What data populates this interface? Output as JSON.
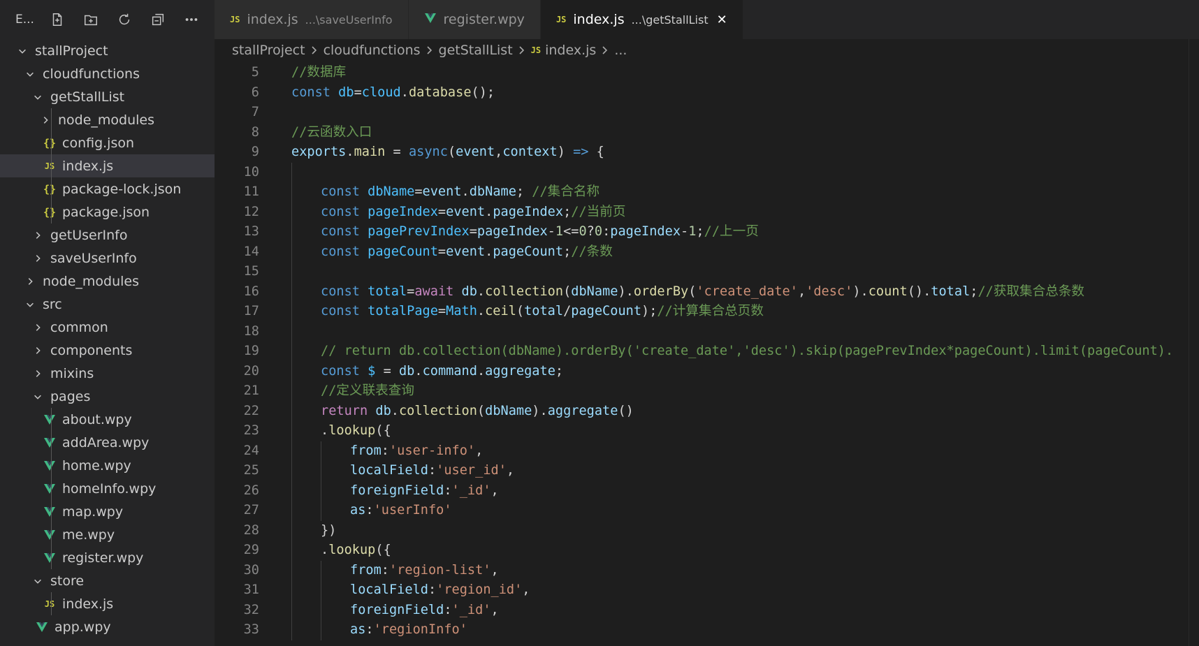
{
  "sidebar": {
    "title": "E...",
    "toolbar_icons": [
      "new-file-icon",
      "new-folder-icon",
      "refresh-icon",
      "collapse-all-icon",
      "more-icon"
    ],
    "tree": [
      {
        "label": "stallProject",
        "type": "folder",
        "open": true,
        "depth": 0
      },
      {
        "label": "cloudfunctions",
        "type": "folder",
        "open": true,
        "depth": 1
      },
      {
        "label": "getStallList",
        "type": "folder",
        "open": true,
        "depth": 2
      },
      {
        "label": "node_modules",
        "type": "folder",
        "open": false,
        "depth": 3
      },
      {
        "label": "config.json",
        "type": "json",
        "depth": 3
      },
      {
        "label": "index.js",
        "type": "js",
        "depth": 3,
        "selected": true
      },
      {
        "label": "package-lock.json",
        "type": "json",
        "depth": 3
      },
      {
        "label": "package.json",
        "type": "json",
        "depth": 3
      },
      {
        "label": "getUserInfo",
        "type": "folder",
        "open": false,
        "depth": 2
      },
      {
        "label": "saveUserInfo",
        "type": "folder",
        "open": false,
        "depth": 2
      },
      {
        "label": "node_modules",
        "type": "folder",
        "open": false,
        "depth": 1
      },
      {
        "label": "src",
        "type": "folder",
        "open": true,
        "depth": 1
      },
      {
        "label": "common",
        "type": "folder",
        "open": false,
        "depth": 2
      },
      {
        "label": "components",
        "type": "folder",
        "open": false,
        "depth": 2
      },
      {
        "label": "mixins",
        "type": "folder",
        "open": false,
        "depth": 2
      },
      {
        "label": "pages",
        "type": "folder",
        "open": true,
        "depth": 2
      },
      {
        "label": "about.wpy",
        "type": "vue",
        "depth": 3
      },
      {
        "label": "addArea.wpy",
        "type": "vue",
        "depth": 3
      },
      {
        "label": "home.wpy",
        "type": "vue",
        "depth": 3
      },
      {
        "label": "homeInfo.wpy",
        "type": "vue",
        "depth": 3
      },
      {
        "label": "map.wpy",
        "type": "vue",
        "depth": 3
      },
      {
        "label": "me.wpy",
        "type": "vue",
        "depth": 3
      },
      {
        "label": "register.wpy",
        "type": "vue",
        "depth": 3
      },
      {
        "label": "store",
        "type": "folder",
        "open": true,
        "depth": 2
      },
      {
        "label": "index.js",
        "type": "js",
        "depth": 3
      },
      {
        "label": "app.wpy",
        "type": "vue",
        "depth": 2
      }
    ]
  },
  "tabs": [
    {
      "label": "index.js",
      "desc": "...\\saveUserInfo",
      "type": "js",
      "active": false
    },
    {
      "label": "register.wpy",
      "desc": "",
      "type": "vue",
      "active": false
    },
    {
      "label": "index.js",
      "desc": "...\\getStallList",
      "type": "js",
      "active": true
    }
  ],
  "breadcrumb": [
    "stallProject",
    "cloudfunctions",
    "getStallList",
    "index.js",
    "..."
  ],
  "icons": {
    "js": "JS",
    "json": "{}"
  },
  "colors": {
    "keyword": "#569cd6",
    "variable": "#4fc1ff",
    "function": "#dcdcaa",
    "string": "#ce9178",
    "comment": "#6a9955",
    "property": "#9cdcfe",
    "number": "#b5cea8",
    "control": "#c586c0",
    "vue": "#41b883"
  },
  "code_lines": [
    {
      "n": "5",
      "indent": 0,
      "t": [
        [
          "c",
          "//数据库"
        ]
      ]
    },
    {
      "n": "6",
      "indent": 0,
      "t": [
        [
          "k",
          "const "
        ],
        [
          "v",
          "db"
        ],
        [
          "w",
          "="
        ],
        [
          "v",
          "cloud"
        ],
        [
          "w",
          "."
        ],
        [
          "f",
          "database"
        ],
        [
          "w",
          "();"
        ]
      ]
    },
    {
      "n": "7",
      "indent": 0,
      "t": []
    },
    {
      "n": "8",
      "indent": 0,
      "t": [
        [
          "c",
          "//云函数入口"
        ]
      ]
    },
    {
      "n": "9",
      "indent": 0,
      "t": [
        [
          "p",
          "exports"
        ],
        [
          "w",
          "."
        ],
        [
          "f",
          "main"
        ],
        [
          "w",
          " = "
        ],
        [
          "k",
          "async"
        ],
        [
          "w",
          "("
        ],
        [
          "p",
          "event"
        ],
        [
          "w",
          ","
        ],
        [
          "p",
          "context"
        ],
        [
          "w",
          ") "
        ],
        [
          "k",
          "=>"
        ],
        [
          "w",
          " {"
        ]
      ]
    },
    {
      "n": "10",
      "indent": 1,
      "t": []
    },
    {
      "n": "11",
      "indent": 1,
      "t": [
        [
          "k",
          "const "
        ],
        [
          "v",
          "dbName"
        ],
        [
          "w",
          "="
        ],
        [
          "p",
          "event"
        ],
        [
          "w",
          "."
        ],
        [
          "p",
          "dbName"
        ],
        [
          "w",
          "; "
        ],
        [
          "c",
          "//集合名称"
        ]
      ]
    },
    {
      "n": "12",
      "indent": 1,
      "t": [
        [
          "k",
          "const "
        ],
        [
          "v",
          "pageIndex"
        ],
        [
          "w",
          "="
        ],
        [
          "p",
          "event"
        ],
        [
          "w",
          "."
        ],
        [
          "p",
          "pageIndex"
        ],
        [
          "w",
          ";"
        ],
        [
          "c",
          "//当前页"
        ]
      ]
    },
    {
      "n": "13",
      "indent": 1,
      "t": [
        [
          "k",
          "const "
        ],
        [
          "v",
          "pagePrevIndex"
        ],
        [
          "w",
          "="
        ],
        [
          "p",
          "pageIndex"
        ],
        [
          "w",
          "-"
        ],
        [
          "n",
          "1"
        ],
        [
          "w",
          "<="
        ],
        [
          "n",
          "0"
        ],
        [
          "w",
          "?"
        ],
        [
          "n",
          "0"
        ],
        [
          "w",
          ":"
        ],
        [
          "p",
          "pageIndex"
        ],
        [
          "w",
          "-"
        ],
        [
          "n",
          "1"
        ],
        [
          "w",
          ";"
        ],
        [
          "c",
          "//上一页"
        ]
      ]
    },
    {
      "n": "14",
      "indent": 1,
      "t": [
        [
          "k",
          "const "
        ],
        [
          "v",
          "pageCount"
        ],
        [
          "w",
          "="
        ],
        [
          "p",
          "event"
        ],
        [
          "w",
          "."
        ],
        [
          "p",
          "pageCount"
        ],
        [
          "w",
          ";"
        ],
        [
          "c",
          "//条数"
        ]
      ]
    },
    {
      "n": "15",
      "indent": 1,
      "t": []
    },
    {
      "n": "16",
      "indent": 1,
      "t": [
        [
          "k",
          "const "
        ],
        [
          "v",
          "total"
        ],
        [
          "w",
          "="
        ],
        [
          "ctl",
          "await "
        ],
        [
          "p",
          "db"
        ],
        [
          "w",
          "."
        ],
        [
          "f",
          "collection"
        ],
        [
          "w",
          "("
        ],
        [
          "p",
          "dbName"
        ],
        [
          "w",
          ")."
        ],
        [
          "f",
          "orderBy"
        ],
        [
          "w",
          "("
        ],
        [
          "s",
          "'create_date'"
        ],
        [
          "w",
          ","
        ],
        [
          "s",
          "'desc'"
        ],
        [
          "w",
          ")."
        ],
        [
          "f",
          "count"
        ],
        [
          "w",
          "()."
        ],
        [
          "p",
          "total"
        ],
        [
          "w",
          ";"
        ],
        [
          "c",
          "//获取集合总条数"
        ]
      ]
    },
    {
      "n": "17",
      "indent": 1,
      "t": [
        [
          "k",
          "const "
        ],
        [
          "v",
          "totalPage"
        ],
        [
          "w",
          "="
        ],
        [
          "v",
          "Math"
        ],
        [
          "w",
          "."
        ],
        [
          "f",
          "ceil"
        ],
        [
          "w",
          "("
        ],
        [
          "p",
          "total"
        ],
        [
          "w",
          "/"
        ],
        [
          "p",
          "pageCount"
        ],
        [
          "w",
          ");"
        ],
        [
          "c",
          "//计算集合总页数"
        ]
      ]
    },
    {
      "n": "18",
      "indent": 1,
      "t": []
    },
    {
      "n": "19",
      "indent": 1,
      "t": [
        [
          "c",
          "// return db.collection(dbName).orderBy('create_date','desc').skip(pagePrevIndex*pageCount).limit(pageCount)."
        ]
      ]
    },
    {
      "n": "20",
      "indent": 1,
      "t": [
        [
          "k",
          "const "
        ],
        [
          "v",
          "$"
        ],
        [
          "w",
          " = "
        ],
        [
          "p",
          "db"
        ],
        [
          "w",
          "."
        ],
        [
          "p",
          "command"
        ],
        [
          "w",
          "."
        ],
        [
          "p",
          "aggregate"
        ],
        [
          "w",
          ";"
        ]
      ]
    },
    {
      "n": "21",
      "indent": 1,
      "t": [
        [
          "c",
          "//定义联表查询"
        ]
      ]
    },
    {
      "n": "22",
      "indent": 1,
      "t": [
        [
          "ctl",
          "return "
        ],
        [
          "p",
          "db"
        ],
        [
          "w",
          "."
        ],
        [
          "f",
          "collection"
        ],
        [
          "w",
          "("
        ],
        [
          "p",
          "dbName"
        ],
        [
          "w",
          ")."
        ],
        [
          "p",
          "aggregate"
        ],
        [
          "w",
          "()"
        ]
      ]
    },
    {
      "n": "23",
      "indent": 1,
      "t": [
        [
          "w",
          "."
        ],
        [
          "f",
          "lookup"
        ],
        [
          "w",
          "({"
        ]
      ]
    },
    {
      "n": "24",
      "indent": 2,
      "t": [
        [
          "p",
          "from"
        ],
        [
          "w",
          ":"
        ],
        [
          "s",
          "'user-info'"
        ],
        [
          "w",
          ","
        ]
      ]
    },
    {
      "n": "25",
      "indent": 2,
      "t": [
        [
          "p",
          "localField"
        ],
        [
          "w",
          ":"
        ],
        [
          "s",
          "'user_id'"
        ],
        [
          "w",
          ","
        ]
      ]
    },
    {
      "n": "26",
      "indent": 2,
      "t": [
        [
          "p",
          "foreignField"
        ],
        [
          "w",
          ":"
        ],
        [
          "s",
          "'_id'"
        ],
        [
          "w",
          ","
        ]
      ]
    },
    {
      "n": "27",
      "indent": 2,
      "t": [
        [
          "p",
          "as"
        ],
        [
          "w",
          ":"
        ],
        [
          "s",
          "'userInfo'"
        ]
      ]
    },
    {
      "n": "28",
      "indent": 1,
      "t": [
        [
          "w",
          "})"
        ]
      ]
    },
    {
      "n": "29",
      "indent": 1,
      "t": [
        [
          "w",
          "."
        ],
        [
          "f",
          "lookup"
        ],
        [
          "w",
          "({"
        ]
      ]
    },
    {
      "n": "30",
      "indent": 2,
      "t": [
        [
          "p",
          "from"
        ],
        [
          "w",
          ":"
        ],
        [
          "s",
          "'region-list'"
        ],
        [
          "w",
          ","
        ]
      ]
    },
    {
      "n": "31",
      "indent": 2,
      "t": [
        [
          "p",
          "localField"
        ],
        [
          "w",
          ":"
        ],
        [
          "s",
          "'region_id'"
        ],
        [
          "w",
          ","
        ]
      ]
    },
    {
      "n": "32",
      "indent": 2,
      "t": [
        [
          "p",
          "foreignField"
        ],
        [
          "w",
          ":"
        ],
        [
          "s",
          "'_id'"
        ],
        [
          "w",
          ","
        ]
      ]
    },
    {
      "n": "33",
      "indent": 2,
      "t": [
        [
          "p",
          "as"
        ],
        [
          "w",
          ":"
        ],
        [
          "s",
          "'regionInfo'"
        ]
      ]
    }
  ]
}
